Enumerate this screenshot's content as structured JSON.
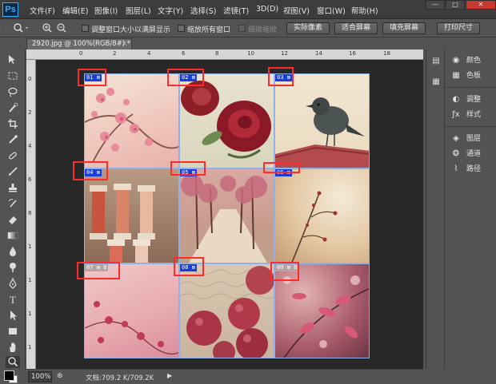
{
  "app": {
    "logo": "Ps"
  },
  "menus": [
    "文件(F)",
    "编辑(E)",
    "图像(I)",
    "图层(L)",
    "文字(Y)",
    "选择(S)",
    "滤镜(T)",
    "3D(D)",
    "视图(V)",
    "窗口(W)",
    "帮助(H)"
  ],
  "window_controls": {
    "minimize": "—",
    "maximize": "□",
    "close": "✕"
  },
  "options": {
    "tool_icon": "magnifier-icon",
    "resize_windows_label": "调整窗口大小以满屏显示",
    "zoom_all_label": "缩放所有窗口",
    "scrubby_zoom_label": "细微缩放",
    "actual_pixels": "实际像素",
    "fit_screen": "适合屏幕",
    "fill_screen": "填充屏幕",
    "print_size": "打印尺寸"
  },
  "document": {
    "tab_title": "2920.jpg @ 100%(RGB/8#) *",
    "close": "×"
  },
  "ruler": {
    "h_ticks": [
      "0",
      "2",
      "4",
      "6",
      "8",
      "10",
      "12",
      "14",
      "16",
      "18"
    ],
    "v_ticks": [
      "0",
      "2",
      "4",
      "6",
      "8",
      "1",
      "1",
      "1",
      "1"
    ]
  },
  "slices": [
    {
      "num": "01",
      "photo": "pink blossoms"
    },
    {
      "num": "02",
      "photo": "red roses"
    },
    {
      "num": "03",
      "photo": "bird on roof"
    },
    {
      "num": "04",
      "photo": "thread spools"
    },
    {
      "num": "05",
      "photo": "tree lined path"
    },
    {
      "num": "06",
      "photo": "dry twigs"
    },
    {
      "num": "07",
      "photo": "pink flowers",
      "badge": "8"
    },
    {
      "num": "08",
      "photo": "apples on knit"
    },
    {
      "num": "09",
      "photo": "pink leaves",
      "badge": "8"
    }
  ],
  "status": {
    "zoom": "100%",
    "doc_info": "文档:709.2 K/709.2K"
  },
  "panels": {
    "color": "颜色",
    "swatches": "色板",
    "adjustments": "调整",
    "styles": "样式",
    "layers": "图层",
    "channels": "通道",
    "paths": "路径"
  },
  "colors": {
    "accent": "#3fa9f5",
    "slice_label": "#1b3fd6",
    "highlight": "#ff2a2a"
  }
}
